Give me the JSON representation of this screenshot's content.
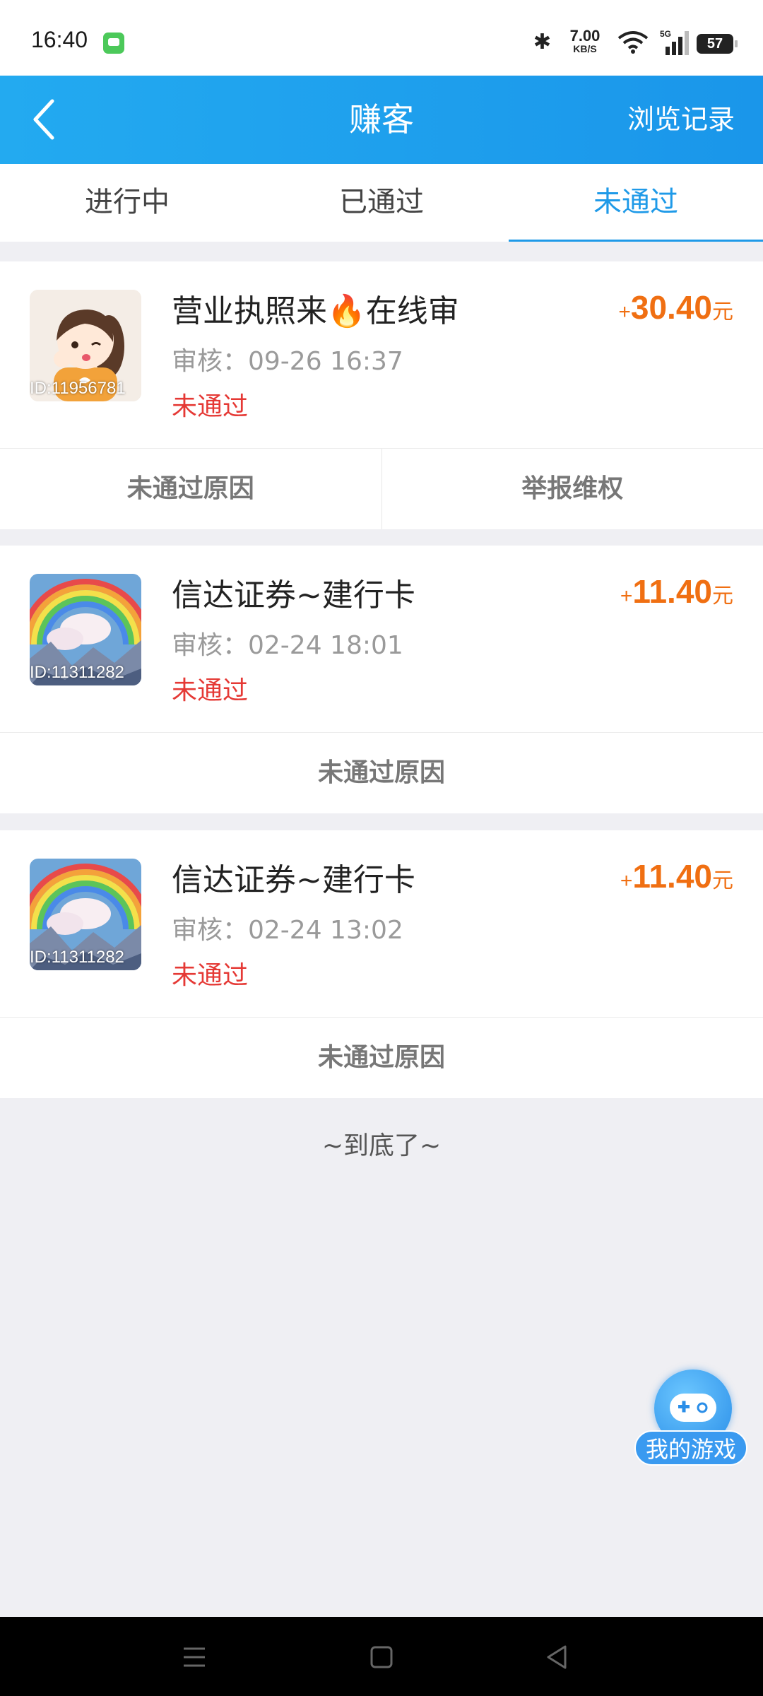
{
  "status_bar": {
    "time": "16:40",
    "net_speed": "7.00",
    "net_unit": "KB/S",
    "battery": "57"
  },
  "header": {
    "title": "赚客",
    "history_label": "浏览记录"
  },
  "tabs": [
    {
      "label": "进行中",
      "active": false
    },
    {
      "label": "已通过",
      "active": false
    },
    {
      "label": "未通过",
      "active": true
    }
  ],
  "tasks": [
    {
      "id_label": "ID:11956781",
      "title": "营业执照来🔥在线审",
      "review": "审核：09-26 16:37",
      "status": "未通过",
      "reward_plus": "+",
      "reward_amount": "30.40",
      "reward_unit": "元",
      "actions": [
        "未通过原因",
        "举报维权"
      ]
    },
    {
      "id_label": "ID:11311282",
      "title": "信达证券~建行卡",
      "review": "审核：02-24 18:01",
      "status": "未通过",
      "reward_plus": "+",
      "reward_amount": "11.40",
      "reward_unit": "元",
      "actions": [
        "未通过原因"
      ]
    },
    {
      "id_label": "ID:11311282",
      "title": "信达证券~建行卡",
      "review": "审核：02-24 13:02",
      "status": "未通过",
      "reward_plus": "+",
      "reward_amount": "11.40",
      "reward_unit": "元",
      "actions": [
        "未通过原因"
      ]
    }
  ],
  "end_text": "~到底了~",
  "fab": {
    "label": "我的游戏"
  },
  "colors": {
    "accent": "#1f9ae8",
    "reward": "#f06f12",
    "fail": "#e53935"
  }
}
